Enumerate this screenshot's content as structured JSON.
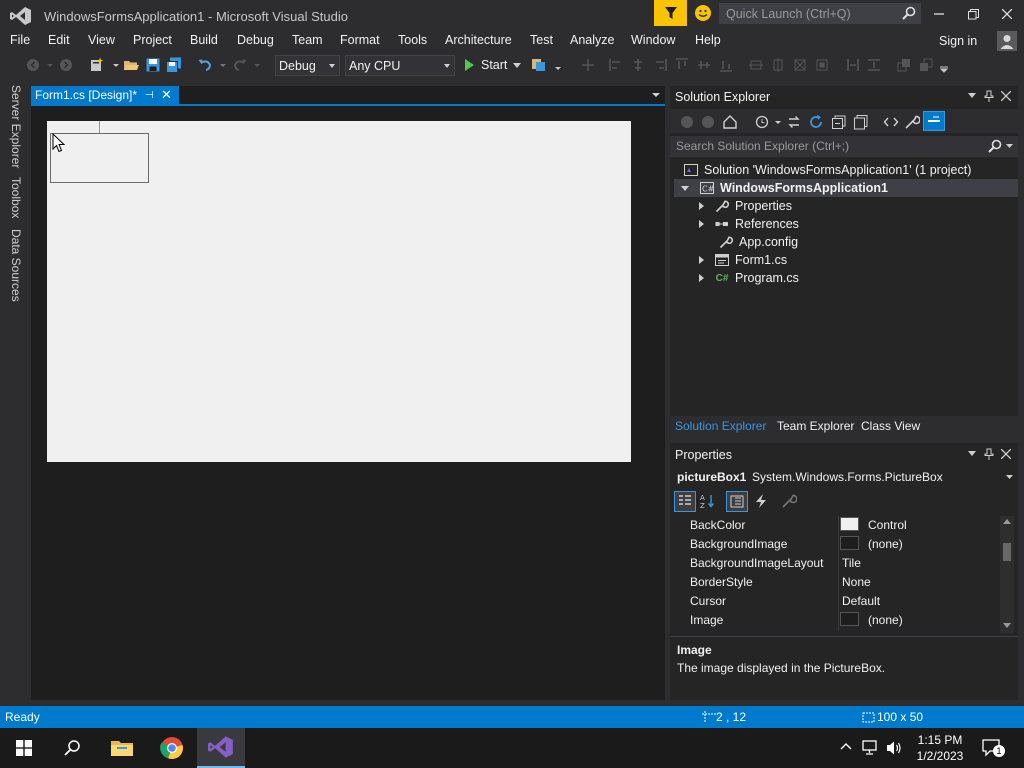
{
  "window": {
    "title": "WindowsFormsApplication1 - Microsoft Visual Studio",
    "quick_launch_placeholder": "Quick Launch (Ctrl+Q)",
    "sign_in": "Sign in"
  },
  "menu": [
    "File",
    "Edit",
    "View",
    "Project",
    "Build",
    "Debug",
    "Team",
    "Format",
    "Tools",
    "Architecture",
    "Test",
    "Analyze",
    "Window",
    "Help"
  ],
  "toolbar": {
    "configuration": "Debug",
    "platform": "Any CPU",
    "start_label": "Start"
  },
  "left_rail": [
    "Server Explorer",
    "Toolbox",
    "Data Sources"
  ],
  "document": {
    "tab_label": "Form1.cs [Design]*"
  },
  "solution_explorer": {
    "title": "Solution Explorer",
    "search_placeholder": "Search Solution Explorer (Ctrl+;)",
    "tree": [
      {
        "label": "Solution 'WindowsFormsApplication1' (1 project)",
        "icon": "solution-icon"
      },
      {
        "label": "WindowsFormsApplication1",
        "icon": "csharp-project-icon",
        "expanded": true,
        "selected": true
      },
      {
        "label": "Properties",
        "icon": "wrench-icon",
        "expandable": true
      },
      {
        "label": "References",
        "icon": "references-icon",
        "expandable": true
      },
      {
        "label": "App.config",
        "icon": "config-file-icon"
      },
      {
        "label": "Form1.cs",
        "icon": "form-icon",
        "expandable": true
      },
      {
        "label": "Program.cs",
        "icon": "csharp-file-icon",
        "expandable": true
      }
    ],
    "tabs": [
      "Solution Explorer",
      "Team Explorer",
      "Class View"
    ],
    "active_tab": 0
  },
  "properties": {
    "title": "Properties",
    "object_name": "pictureBox1",
    "object_type": "System.Windows.Forms.PictureBox",
    "rows": [
      {
        "name": "BackColor",
        "value": "Control",
        "swatch": "#f0f0f0"
      },
      {
        "name": "BackgroundImage",
        "value": "(none)",
        "swatch": "#1e1e1e"
      },
      {
        "name": "BackgroundImageLayout",
        "value": "Tile"
      },
      {
        "name": "BorderStyle",
        "value": "None"
      },
      {
        "name": "Cursor",
        "value": "Default"
      },
      {
        "name": "Image",
        "value": "(none)",
        "swatch": "#1e1e1e"
      }
    ],
    "description_title": "Image",
    "description_text": "The image displayed in the PictureBox."
  },
  "status": {
    "text": "Ready",
    "position": "2 , 12",
    "size": "100 x 50"
  },
  "taskbar": {
    "time": "1:15 PM",
    "date": "1/2/2023",
    "notification_count": "1"
  },
  "colors": {
    "accent": "#007acc",
    "filter_yellow": "#f8c400",
    "vs_purple": "#865fc5"
  }
}
